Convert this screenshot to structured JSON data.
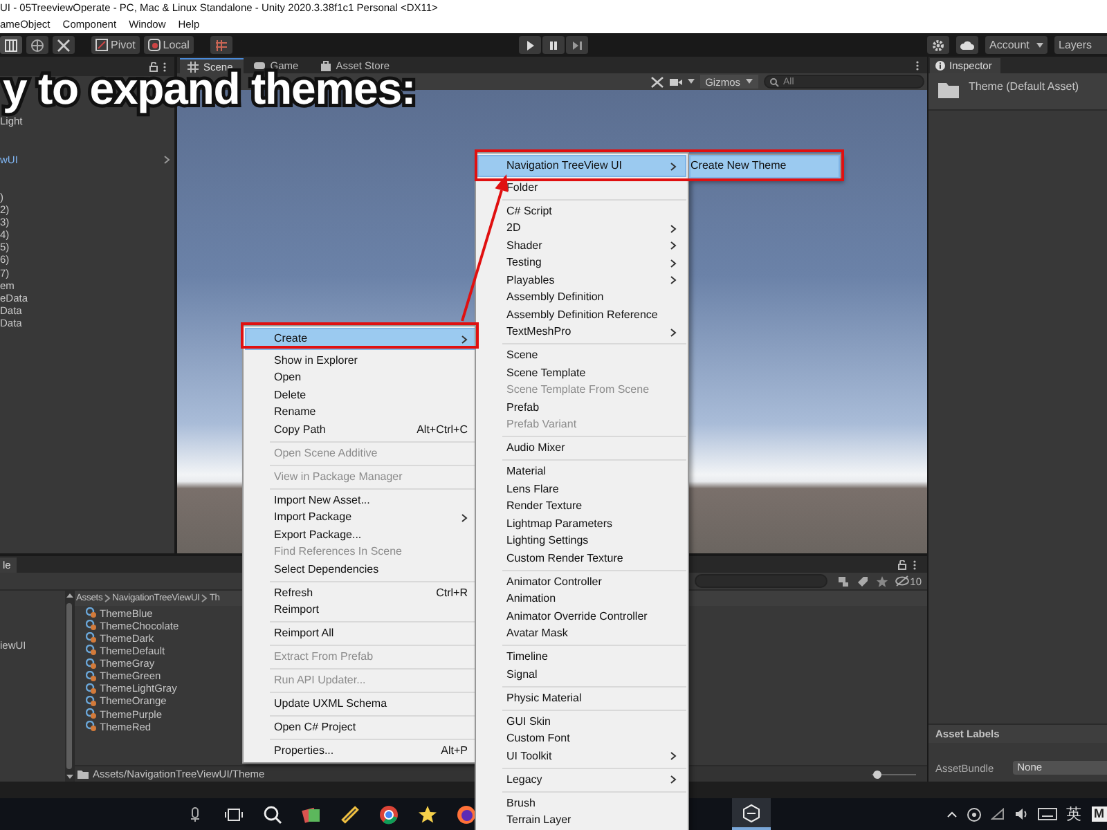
{
  "window": {
    "title": "UI - 05TreeviewOperate - PC, Mac & Linux Standalone - Unity 2020.3.38f1c1 Personal <DX11>"
  },
  "menu_bar": [
    {
      "label": "ameObject"
    },
    {
      "label": "Component"
    },
    {
      "label": "Window"
    },
    {
      "label": "Help"
    }
  ],
  "toolbar": {
    "pivot": "Pivot",
    "local": "Local",
    "account": "Account",
    "layers": "Layers"
  },
  "caption": "y to expand themes:",
  "hierarchy": {
    "items": [
      {
        "label": "Light",
        "kind": "object"
      },
      {
        "label": "wUI",
        "kind": "prefab"
      },
      {
        "label": ")",
        "kind": "object"
      },
      {
        "label": "2)",
        "kind": "object"
      },
      {
        "label": "3)",
        "kind": "object"
      },
      {
        "label": "4)",
        "kind": "object"
      },
      {
        "label": "5)",
        "kind": "object"
      },
      {
        "label": "6)",
        "kind": "object"
      },
      {
        "label": "7)",
        "kind": "object"
      },
      {
        "label": "em",
        "kind": "object"
      },
      {
        "label": "eData",
        "kind": "object"
      },
      {
        "label": "Data",
        "kind": "object"
      },
      {
        "label": "Data",
        "kind": "object"
      }
    ]
  },
  "scene": {
    "tabs": [
      {
        "label": "Scene",
        "selected": true
      },
      {
        "label": "Game",
        "selected": false
      },
      {
        "label": "Asset Store",
        "selected": false
      }
    ],
    "gizmos": "Gizmos",
    "search": {
      "placeholder": "All"
    }
  },
  "inspector": {
    "tab": "Inspector",
    "asset_name": "Theme (Default Asset)",
    "labels_header": "Asset Labels",
    "asset_bundle": {
      "label": "AssetBundle",
      "value": "None"
    }
  },
  "project": {
    "tab": "le",
    "hidden_count": "10",
    "folder_tree": [
      {
        "label": "iewUI"
      }
    ],
    "breadcrumb": [
      "Assets",
      "NavigationTreeViewUI",
      "Th"
    ],
    "files": [
      "ThemeBlue",
      "ThemeChocolate",
      "ThemeDark",
      "ThemeDefault",
      "ThemeGray",
      "ThemeGreen",
      "ThemeLightGray",
      "ThemeOrange",
      "ThemePurple",
      "ThemeRed"
    ],
    "path": "Assets/NavigationTreeViewUI/Theme",
    "zoom": {
      "level": 0.05
    }
  },
  "context_menus": [
    {
      "items": [
        {
          "kind": "item",
          "label": "Create",
          "selected": true,
          "disabled": false,
          "submenu": true
        },
        {
          "kind": "item",
          "label": "Show in Explorer",
          "selected": false,
          "disabled": false,
          "submenu": false
        },
        {
          "kind": "item",
          "label": "Open",
          "selected": false,
          "disabled": false,
          "submenu": false
        },
        {
          "kind": "item",
          "label": "Delete",
          "selected": false,
          "disabled": false,
          "submenu": false
        },
        {
          "kind": "item",
          "label": "Rename",
          "selected": false,
          "disabled": false,
          "submenu": false
        },
        {
          "kind": "item",
          "label": "Copy Path",
          "shortcut": "Alt+Ctrl+C",
          "selected": false,
          "disabled": false,
          "submenu": false
        },
        {
          "kind": "separator"
        },
        {
          "kind": "item",
          "label": "Open Scene Additive",
          "selected": false,
          "disabled": true,
          "submenu": false
        },
        {
          "kind": "separator"
        },
        {
          "kind": "item",
          "label": "View in Package Manager",
          "selected": false,
          "disabled": true,
          "submenu": false
        },
        {
          "kind": "separator"
        },
        {
          "kind": "item",
          "label": "Import New Asset...",
          "selected": false,
          "disabled": false,
          "submenu": false
        },
        {
          "kind": "item",
          "label": "Import Package",
          "selected": false,
          "disabled": false,
          "submenu": true
        },
        {
          "kind": "item",
          "label": "Export Package...",
          "selected": false,
          "disabled": false,
          "submenu": false
        },
        {
          "kind": "item",
          "label": "Find References In Scene",
          "selected": false,
          "disabled": true,
          "submenu": false
        },
        {
          "kind": "item",
          "label": "Select Dependencies",
          "selected": false,
          "disabled": false,
          "submenu": false
        },
        {
          "kind": "separator"
        },
        {
          "kind": "item",
          "label": "Refresh",
          "shortcut": "Ctrl+R",
          "selected": false,
          "disabled": false,
          "submenu": false
        },
        {
          "kind": "item",
          "label": "Reimport",
          "selected": false,
          "disabled": false,
          "submenu": false
        },
        {
          "kind": "separator"
        },
        {
          "kind": "item",
          "label": "Reimport All",
          "selected": false,
          "disabled": false,
          "submenu": false
        },
        {
          "kind": "separator"
        },
        {
          "kind": "item",
          "label": "Extract From Prefab",
          "selected": false,
          "disabled": true,
          "submenu": false
        },
        {
          "kind": "separator"
        },
        {
          "kind": "item",
          "label": "Run API Updater...",
          "selected": false,
          "disabled": true,
          "submenu": false
        },
        {
          "kind": "separator"
        },
        {
          "kind": "item",
          "label": "Update UXML Schema",
          "selected": false,
          "disabled": false,
          "submenu": false
        },
        {
          "kind": "separator"
        },
        {
          "kind": "item",
          "label": "Open C# Project",
          "selected": false,
          "disabled": false,
          "submenu": false
        },
        {
          "kind": "separator"
        },
        {
          "kind": "item",
          "label": "Properties...",
          "shortcut": "Alt+P",
          "selected": false,
          "disabled": false,
          "submenu": false
        }
      ]
    },
    {
      "items": [
        {
          "kind": "item",
          "label": "Navigation TreeView UI",
          "selected": true,
          "disabled": false,
          "submenu": true
        },
        {
          "kind": "item",
          "label": "Folder",
          "selected": false,
          "disabled": false,
          "submenu": false
        },
        {
          "kind": "separator"
        },
        {
          "kind": "item",
          "label": "C# Script",
          "selected": false,
          "disabled": false,
          "submenu": false
        },
        {
          "kind": "item",
          "label": "2D",
          "selected": false,
          "disabled": false,
          "submenu": true
        },
        {
          "kind": "item",
          "label": "Shader",
          "selected": false,
          "disabled": false,
          "submenu": true
        },
        {
          "kind": "item",
          "label": "Testing",
          "selected": false,
          "disabled": false,
          "submenu": true
        },
        {
          "kind": "item",
          "label": "Playables",
          "selected": false,
          "disabled": false,
          "submenu": true
        },
        {
          "kind": "item",
          "label": "Assembly Definition",
          "selected": false,
          "disabled": false,
          "submenu": false
        },
        {
          "kind": "item",
          "label": "Assembly Definition Reference",
          "selected": false,
          "disabled": false,
          "submenu": false
        },
        {
          "kind": "item",
          "label": "TextMeshPro",
          "selected": false,
          "disabled": false,
          "submenu": true
        },
        {
          "kind": "separator"
        },
        {
          "kind": "item",
          "label": "Scene",
          "selected": false,
          "disabled": false,
          "submenu": false
        },
        {
          "kind": "item",
          "label": "Scene Template",
          "selected": false,
          "disabled": false,
          "submenu": false
        },
        {
          "kind": "item",
          "label": "Scene Template From Scene",
          "selected": false,
          "disabled": true,
          "submenu": false
        },
        {
          "kind": "item",
          "label": "Prefab",
          "selected": false,
          "disabled": false,
          "submenu": false
        },
        {
          "kind": "item",
          "label": "Prefab Variant",
          "selected": false,
          "disabled": true,
          "submenu": false
        },
        {
          "kind": "separator"
        },
        {
          "kind": "item",
          "label": "Audio Mixer",
          "selected": false,
          "disabled": false,
          "submenu": false
        },
        {
          "kind": "separator"
        },
        {
          "kind": "item",
          "label": "Material",
          "selected": false,
          "disabled": false,
          "submenu": false
        },
        {
          "kind": "item",
          "label": "Lens Flare",
          "selected": false,
          "disabled": false,
          "submenu": false
        },
        {
          "kind": "item",
          "label": "Render Texture",
          "selected": false,
          "disabled": false,
          "submenu": false
        },
        {
          "kind": "item",
          "label": "Lightmap Parameters",
          "selected": false,
          "disabled": false,
          "submenu": false
        },
        {
          "kind": "item",
          "label": "Lighting Settings",
          "selected": false,
          "disabled": false,
          "submenu": false
        },
        {
          "kind": "item",
          "label": "Custom Render Texture",
          "selected": false,
          "disabled": false,
          "submenu": false
        },
        {
          "kind": "separator"
        },
        {
          "kind": "item",
          "label": "Animator Controller",
          "selected": false,
          "disabled": false,
          "submenu": false
        },
        {
          "kind": "item",
          "label": "Animation",
          "selected": false,
          "disabled": false,
          "submenu": false
        },
        {
          "kind": "item",
          "label": "Animator Override Controller",
          "selected": false,
          "disabled": false,
          "submenu": false
        },
        {
          "kind": "item",
          "label": "Avatar Mask",
          "selected": false,
          "disabled": false,
          "submenu": false
        },
        {
          "kind": "separator"
        },
        {
          "kind": "item",
          "label": "Timeline",
          "selected": false,
          "disabled": false,
          "submenu": false
        },
        {
          "kind": "item",
          "label": "Signal",
          "selected": false,
          "disabled": false,
          "submenu": false
        },
        {
          "kind": "separator"
        },
        {
          "kind": "item",
          "label": "Physic Material",
          "selected": false,
          "disabled": false,
          "submenu": false
        },
        {
          "kind": "separator"
        },
        {
          "kind": "item",
          "label": "GUI Skin",
          "selected": false,
          "disabled": false,
          "submenu": false
        },
        {
          "kind": "item",
          "label": "Custom Font",
          "selected": false,
          "disabled": false,
          "submenu": false
        },
        {
          "kind": "item",
          "label": "UI Toolkit",
          "selected": false,
          "disabled": false,
          "submenu": true
        },
        {
          "kind": "separator"
        },
        {
          "kind": "item",
          "label": "Legacy",
          "selected": false,
          "disabled": false,
          "submenu": true
        },
        {
          "kind": "separator"
        },
        {
          "kind": "item",
          "label": "Brush",
          "selected": false,
          "disabled": false,
          "submenu": false
        },
        {
          "kind": "item",
          "label": "Terrain Layer",
          "selected": false,
          "disabled": false,
          "submenu": false
        }
      ]
    },
    {
      "items": [
        {
          "kind": "item",
          "label": "Create New Theme",
          "selected": true,
          "disabled": false,
          "submenu": false
        }
      ]
    }
  ],
  "taskbar": {
    "ime": "英",
    "badge": "M"
  }
}
